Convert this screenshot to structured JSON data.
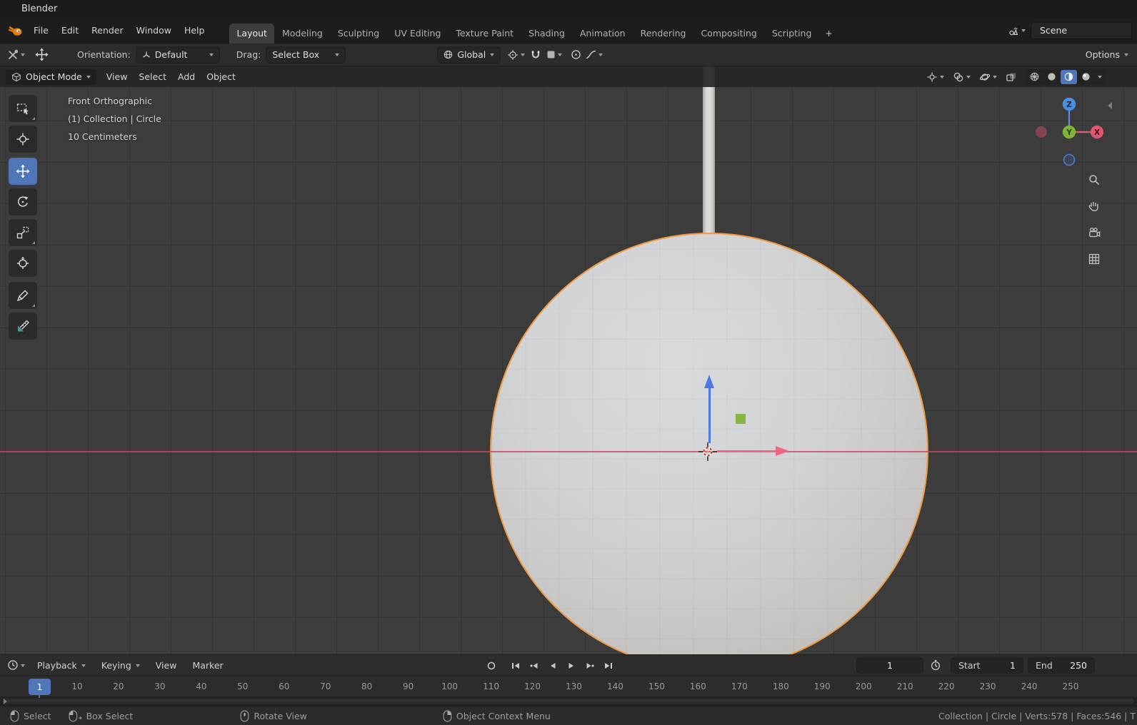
{
  "window": {
    "title": "Blender"
  },
  "topbar": {
    "menus": [
      "File",
      "Edit",
      "Render",
      "Window",
      "Help"
    ],
    "tabs": [
      "Layout",
      "Modeling",
      "Sculpting",
      "UV Editing",
      "Texture Paint",
      "Shading",
      "Animation",
      "Rendering",
      "Compositing",
      "Scripting"
    ],
    "active_tab": "Layout",
    "add_tab_label": "+",
    "scene_selector": {
      "value": "Scene"
    }
  },
  "tool_settings": {
    "orientation_label": "Orientation:",
    "orientation_value": "Default",
    "drag_label": "Drag:",
    "drag_value": "Select Box",
    "transform_orientation_value": "Global",
    "options_button": "Options"
  },
  "viewport": {
    "mode_selector": "Object Mode",
    "menus": [
      "View",
      "Select",
      "Add",
      "Object"
    ],
    "overlay_text": {
      "view_name": "Front Orthographic",
      "active_object": "(1) Collection | Circle",
      "grid_scale": "10 Centimeters"
    },
    "nav_gizmo": {
      "x_label": "X",
      "y_label": "Y",
      "z_label": "Z"
    },
    "active_tool": "move",
    "active_shading": "material-preview"
  },
  "timeline": {
    "menus": [
      {
        "label": "Playback",
        "dropdown": true
      },
      {
        "label": "Keying",
        "dropdown": true
      },
      {
        "label": "View",
        "dropdown": false
      },
      {
        "label": "Marker",
        "dropdown": false
      }
    ],
    "current_frame": "1",
    "start": {
      "label": "Start",
      "value": "1"
    },
    "end": {
      "label": "End",
      "value": "250"
    },
    "ruler_frames": [
      "1",
      "10",
      "20",
      "30",
      "40",
      "50",
      "60",
      "70",
      "80",
      "90",
      "100",
      "110",
      "120",
      "130",
      "140",
      "150",
      "160",
      "170",
      "180",
      "190",
      "200",
      "210",
      "220",
      "230",
      "240",
      "250"
    ]
  },
  "status_bar": {
    "hints": [
      {
        "icon": "mouse-left",
        "label": "Select"
      },
      {
        "icon": "mouse-left-drag",
        "label": "Box Select"
      },
      {
        "icon": "mouse-middle",
        "label": "Rotate View"
      },
      {
        "icon": "mouse-right",
        "label": "Object Context Menu"
      }
    ],
    "scene_stats": "Collection | Circle | Verts:578 | Faces:546 | T"
  },
  "colors": {
    "accent_blue": "#4f76b8",
    "selection_outline": "#f09a43",
    "axis_x_red": "#c94a58",
    "gizmo_x": "#ef6683",
    "gizmo_y": "#83b43c",
    "gizmo_z": "#4d79e8"
  }
}
